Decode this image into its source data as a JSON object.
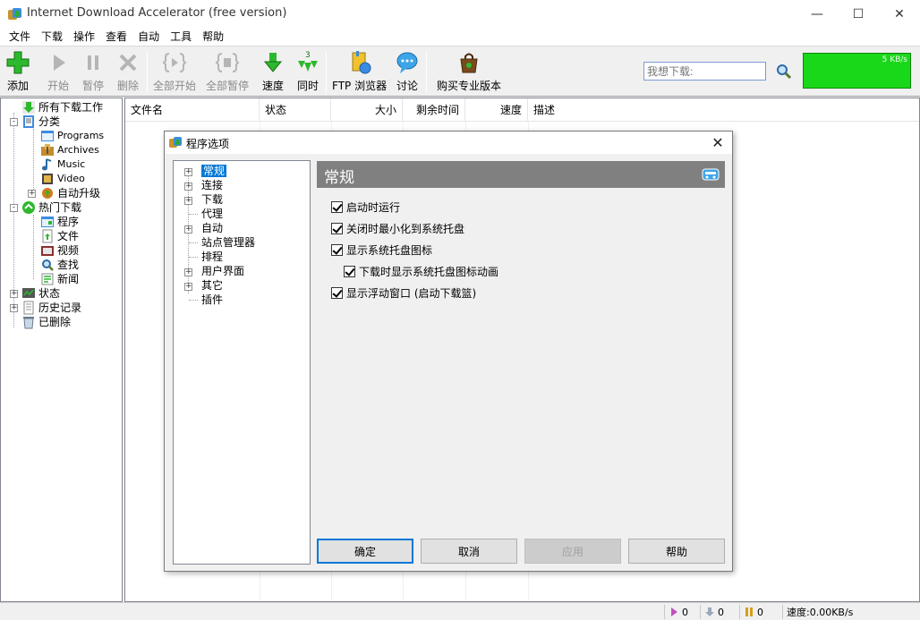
{
  "window": {
    "title": "Internet Download Accelerator (free version)",
    "controls": {
      "minimize": "—",
      "maximize": "☐",
      "close": "✕"
    }
  },
  "menu": [
    "文件",
    "下载",
    "操作",
    "查看",
    "自动",
    "工具",
    "帮助"
  ],
  "toolbar": {
    "add": "添加",
    "start": "开始",
    "pause": "暂停",
    "delete": "删除",
    "start_all": "全部开始",
    "pause_all": "全部暂停",
    "speed": "速度",
    "simultaneous": "同时",
    "simultaneous_count": "3",
    "ftp_browser": "FTP 浏览器",
    "discuss": "讨论",
    "buy_pro": "购买专业版本",
    "search_placeholder": "我想下载:",
    "speed_readout": "5 KB/s"
  },
  "colors": {
    "accent": "#0078d7",
    "speed_graph": "#19d719",
    "panel_head": "#808080"
  },
  "tree": {
    "all_downloads": "所有下载工作",
    "categories": "分类",
    "programs": "Programs",
    "archives": "Archives",
    "music": "Music",
    "video": "Video",
    "auto_upgrade": "自动升级",
    "hot_downloads": "热门下载",
    "hot_programs": "程序",
    "hot_files": "文件",
    "hot_video": "视频",
    "hot_search": "查找",
    "hot_news": "新闻",
    "status": "状态",
    "history": "历史记录",
    "deleted": "已删除"
  },
  "columns": [
    "文件名",
    "状态",
    "大小",
    "剩余时间",
    "速度",
    "描述"
  ],
  "statusbar": {
    "active": "0",
    "queued": "0",
    "paused": "0",
    "speed": "速度:0.00KB/s"
  },
  "dialog": {
    "title": "程序选项",
    "tree": [
      "常规",
      "连接",
      "下载",
      "代理",
      "自动",
      "站点管理器",
      "排程",
      "用户界面",
      "其它",
      "插件"
    ],
    "panel_title": "常规",
    "options": {
      "run_at_startup": "启动时运行",
      "minimize_to_tray": "关闭时最小化到系统托盘",
      "show_tray_icon": "显示系统托盘图标",
      "animate_tray_icon": "下载时显示系统托盘图标动画",
      "show_float_window": "显示浮动窗口 (启动下载篮)"
    },
    "buttons": {
      "ok": "确定",
      "cancel": "取消",
      "apply": "应用",
      "help": "帮助"
    }
  }
}
